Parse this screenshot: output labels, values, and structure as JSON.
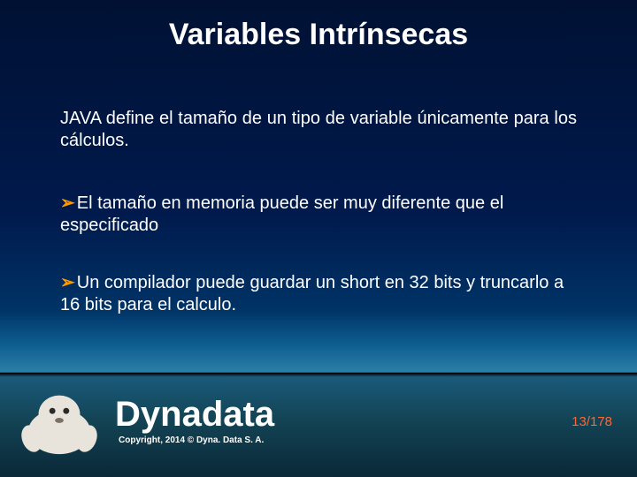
{
  "title": "Variables Intrínsecas",
  "intro": "JAVA define el tamaño de un tipo de variable únicamente para los cálculos.",
  "bullets": [
    "El tamaño en memoria puede ser muy diferente que el especificado",
    "Un compilador puede guardar un short en 32 bits y truncarlo a 16 bits para el calculo."
  ],
  "bullet_marker": "➢",
  "logo": "Dynadata",
  "copyright": "Copyright, 2014 © Dyna. Data S. A.",
  "page": "13/178",
  "colors": {
    "bullet_arrow": "#ff9900",
    "page_number": "#ff6633"
  }
}
